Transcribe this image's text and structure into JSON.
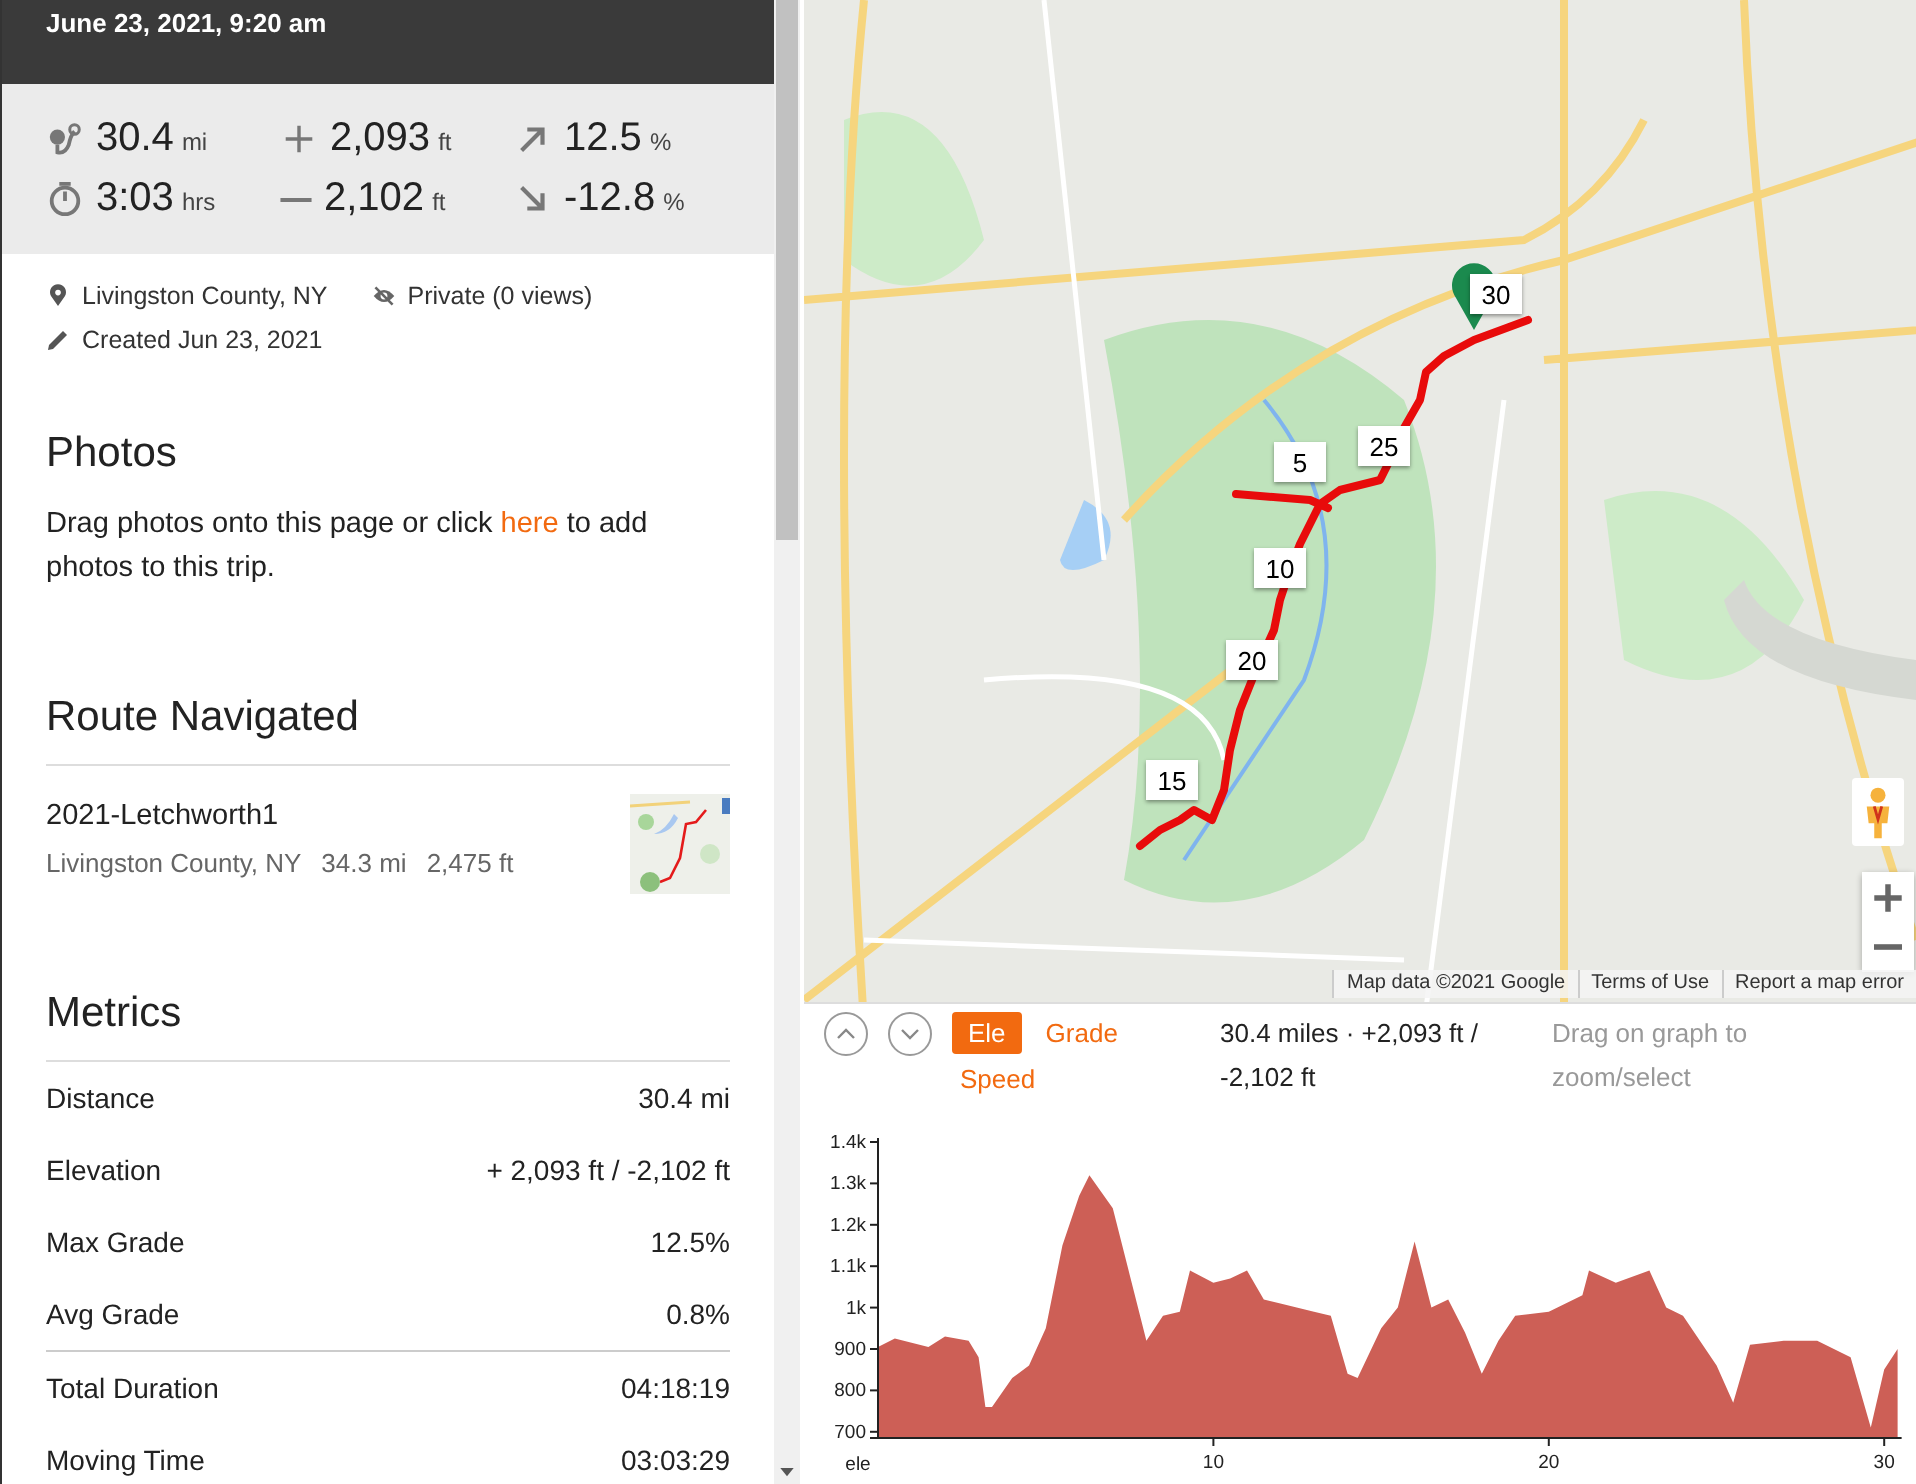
{
  "header": {
    "date": "June 23, 2021, 9:20 am"
  },
  "stats": [
    {
      "kind": "distance",
      "value": "30.4",
      "unit": "mi"
    },
    {
      "kind": "gain",
      "value": "2,093",
      "unit": "ft"
    },
    {
      "kind": "max_grade",
      "value": "12.5",
      "unit": "%"
    },
    {
      "kind": "time",
      "value": "3:03",
      "unit": "hrs"
    },
    {
      "kind": "loss",
      "value": "2,102",
      "unit": "ft"
    },
    {
      "kind": "min_grade",
      "value": "-12.8",
      "unit": "%"
    }
  ],
  "meta": [
    {
      "kind": "location",
      "text": "Livingston County, NY"
    },
    {
      "kind": "privacy",
      "text": "Private (0 views)"
    },
    {
      "kind": "created",
      "text": "Created Jun 23, 2021"
    }
  ],
  "photos": {
    "title": "Photos",
    "text_before": "Drag photos onto this page or click",
    "link": "here",
    "text_after": "to add photos to this trip."
  },
  "route": {
    "title": "Route Navigated",
    "name": "2021-Letchworth1",
    "details": [
      "Livingston County, NY",
      "34.3 mi",
      "2,475 ft"
    ]
  },
  "metrics": {
    "title": "Metrics",
    "groups": [
      [
        {
          "label": "Distance",
          "value": "30.4 mi"
        },
        {
          "label": "Elevation",
          "value": "+ 2,093 ft / -2,102 ft"
        },
        {
          "label": "Max Grade",
          "value": "12.5%"
        },
        {
          "label": "Avg Grade",
          "value": "0.8%"
        }
      ],
      [
        {
          "label": "Total Duration",
          "value": "04:18:19"
        },
        {
          "label": "Moving Time",
          "value": "03:03:29"
        }
      ]
    ]
  },
  "map": {
    "kind": "picture",
    "markers": [
      "30",
      "5",
      "25",
      "10",
      "20",
      "15"
    ],
    "attribution": [
      "Map data ©2021 Google",
      "Terms of Use",
      "Report a map error"
    ]
  },
  "graph": {
    "tabs": [
      {
        "label": "Ele",
        "selected": true
      },
      {
        "label": "Grade",
        "selected": false
      },
      {
        "label": "Speed",
        "selected": false
      }
    ],
    "summary": "30.4 miles · +2,093 ft / -2,102 ft",
    "hint": "Drag on graph to zoom/select",
    "chart_data": {
      "type": "area",
      "x": [
        0,
        0.5,
        1.5,
        2,
        2.7,
        3,
        3.2,
        3.4,
        4,
        4.5,
        5,
        5.5,
        6,
        6.3,
        7,
        7.5,
        8,
        8.5,
        9,
        9.3,
        10,
        10.5,
        11,
        11.5,
        12,
        13,
        13.5,
        14,
        14.3,
        15,
        15.5,
        16,
        16.5,
        17,
        17.5,
        18,
        18.5,
        19,
        20,
        21,
        21.2,
        22,
        23,
        23.5,
        24,
        25,
        25.5,
        26,
        27,
        28,
        29,
        29.6,
        30,
        30.4
      ],
      "series": [
        {
          "name": "ele",
          "color": "#cd5f56",
          "values": [
            905,
            925,
            905,
            930,
            920,
            880,
            760,
            760,
            830,
            860,
            950,
            1150,
            1270,
            1320,
            1240,
            1080,
            920,
            980,
            990,
            1090,
            1060,
            1070,
            1090,
            1020,
            1010,
            990,
            980,
            840,
            830,
            950,
            1000,
            1160,
            1000,
            1020,
            940,
            840,
            920,
            980,
            990,
            1030,
            1090,
            1060,
            1090,
            1000,
            980,
            860,
            770,
            910,
            920,
            920,
            880,
            710,
            850,
            900
          ]
        }
      ],
      "xlim": [
        0,
        30.4
      ],
      "ylim": [
        685,
        1400
      ],
      "xticks": [
        10,
        20,
        30
      ],
      "yticks": [
        {
          "value": 700,
          "label": "700"
        },
        {
          "value": 800,
          "label": "800"
        },
        {
          "value": 900,
          "label": "900"
        },
        {
          "value": 1000,
          "label": "1k"
        },
        {
          "value": 1100,
          "label": "1.1k"
        },
        {
          "value": 1200,
          "label": "1.2k"
        },
        {
          "value": 1300,
          "label": "1.3k"
        },
        {
          "value": 1400,
          "label": "1.4k"
        }
      ]
    }
  }
}
